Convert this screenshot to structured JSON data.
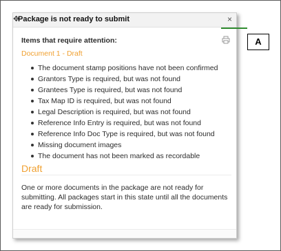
{
  "dialog": {
    "title": "Package is not ready to submit",
    "close_glyph": "×"
  },
  "attention": {
    "heading": "Items that require attention:",
    "document_link": "Document 1 - Draft",
    "issues": [
      "The document stamp positions have not been confirmed",
      "Grantors Type is required, but was not found",
      "Grantees Type is required, but was not found",
      "Tax Map ID is required, but was not found",
      "Legal Description is required, but was not found",
      "Reference Info Entry is required, but was not found",
      "Reference Info Doc Type is required, but was not found",
      "Missing document images",
      "The document has not been marked as recordable"
    ]
  },
  "status": {
    "heading": "Draft",
    "description": "One or more documents in the package are not ready for submitting. All packages start in this state until all the documents are ready for submission."
  },
  "callout": {
    "label": "A"
  },
  "icons": {
    "move": "move-icon",
    "print": "printer-icon"
  },
  "colors": {
    "accent": "#f0a030",
    "callout_line": "#2e8b2e"
  }
}
